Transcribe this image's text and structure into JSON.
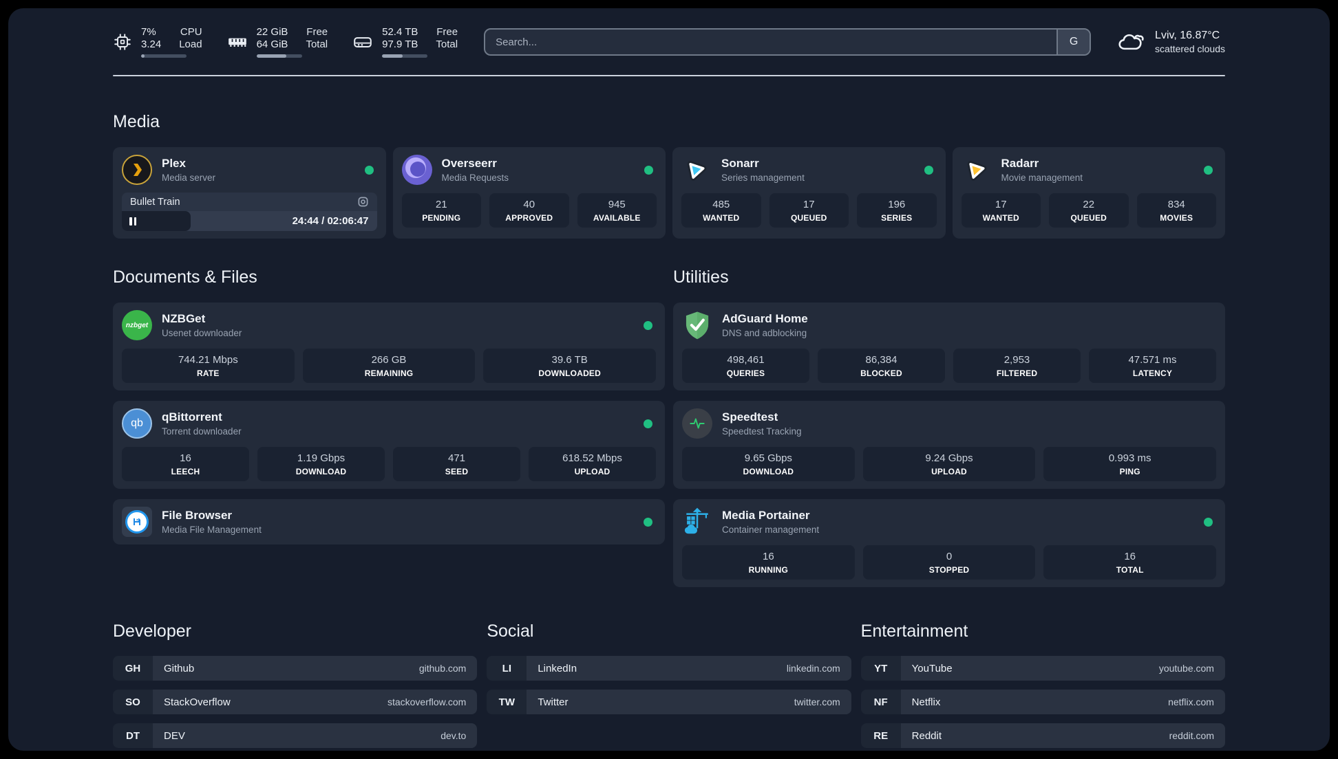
{
  "header": {
    "system_stats": [
      {
        "icon": "cpu-icon",
        "value1": "7%",
        "label1": "CPU",
        "value2": "3.24",
        "label2": "Load",
        "progress_pct": 8
      },
      {
        "icon": "ram-icon",
        "value1": "22 GiB",
        "label1": "Free",
        "value2": "64 GiB",
        "label2": "Total",
        "progress_pct": 66
      },
      {
        "icon": "disk-icon",
        "value1": "52.4 TB",
        "label1": "Free",
        "value2": "97.9 TB",
        "label2": "Total",
        "progress_pct": 46
      }
    ],
    "search": {
      "placeholder": "Search...",
      "button_label": "G"
    },
    "weather": {
      "location_temp": "Lviv, 16.87°C",
      "condition": "scattered clouds"
    }
  },
  "media": {
    "title": "Media",
    "plex": {
      "name": "Plex",
      "subtitle": "Media server",
      "stream": {
        "title": "Bullet Train",
        "time": "24:44 / 02:06:47",
        "progress_pct": 27
      }
    },
    "overseerr": {
      "name": "Overseerr",
      "subtitle": "Media Requests",
      "stats": [
        {
          "value": "21",
          "label": "PENDING"
        },
        {
          "value": "40",
          "label": "APPROVED"
        },
        {
          "value": "945",
          "label": "AVAILABLE"
        }
      ]
    },
    "sonarr": {
      "name": "Sonarr",
      "subtitle": "Series management",
      "stats": [
        {
          "value": "485",
          "label": "WANTED"
        },
        {
          "value": "17",
          "label": "QUEUED"
        },
        {
          "value": "196",
          "label": "SERIES"
        }
      ]
    },
    "radarr": {
      "name": "Radarr",
      "subtitle": "Movie management",
      "stats": [
        {
          "value": "17",
          "label": "WANTED"
        },
        {
          "value": "22",
          "label": "QUEUED"
        },
        {
          "value": "834",
          "label": "MOVIES"
        }
      ]
    }
  },
  "documents": {
    "title": "Documents & Files",
    "nzbget": {
      "name": "NZBGet",
      "subtitle": "Usenet downloader",
      "icon_text": "nzbget",
      "stats": [
        {
          "value": "744.21 Mbps",
          "label": "RATE"
        },
        {
          "value": "266 GB",
          "label": "REMAINING"
        },
        {
          "value": "39.6 TB",
          "label": "DOWNLOADED"
        }
      ]
    },
    "qbittorrent": {
      "name": "qBittorrent",
      "subtitle": "Torrent downloader",
      "icon_text": "qb",
      "stats": [
        {
          "value": "16",
          "label": "LEECH"
        },
        {
          "value": "1.19 Gbps",
          "label": "DOWNLOAD"
        },
        {
          "value": "471",
          "label": "SEED"
        },
        {
          "value": "618.52 Mbps",
          "label": "UPLOAD"
        }
      ]
    },
    "filebrowser": {
      "name": "File Browser",
      "subtitle": "Media File Management"
    }
  },
  "utilities": {
    "title": "Utilities",
    "adguard": {
      "name": "AdGuard Home",
      "subtitle": "DNS and adblocking",
      "stats": [
        {
          "value": "498,461",
          "label": "QUERIES"
        },
        {
          "value": "86,384",
          "label": "BLOCKED"
        },
        {
          "value": "2,953",
          "label": "FILTERED"
        },
        {
          "value": "47.571 ms",
          "label": "LATENCY"
        }
      ]
    },
    "speedtest": {
      "name": "Speedtest",
      "subtitle": "Speedtest Tracking",
      "stats": [
        {
          "value": "9.65 Gbps",
          "label": "DOWNLOAD"
        },
        {
          "value": "9.24 Gbps",
          "label": "UPLOAD"
        },
        {
          "value": "0.993 ms",
          "label": "PING"
        }
      ]
    },
    "portainer": {
      "name": "Media Portainer",
      "subtitle": "Container management",
      "stats": [
        {
          "value": "16",
          "label": "RUNNING"
        },
        {
          "value": "0",
          "label": "STOPPED"
        },
        {
          "value": "16",
          "label": "TOTAL"
        }
      ]
    }
  },
  "bookmarks": [
    {
      "title": "Developer",
      "links": [
        {
          "abbr": "GH",
          "name": "Github",
          "url": "github.com"
        },
        {
          "abbr": "SO",
          "name": "StackOverflow",
          "url": "stackoverflow.com"
        },
        {
          "abbr": "DT",
          "name": "DEV",
          "url": "dev.to"
        }
      ]
    },
    {
      "title": "Social",
      "links": [
        {
          "abbr": "LI",
          "name": "LinkedIn",
          "url": "linkedin.com"
        },
        {
          "abbr": "TW",
          "name": "Twitter",
          "url": "twitter.com"
        }
      ]
    },
    {
      "title": "Entertainment",
      "links": [
        {
          "abbr": "YT",
          "name": "YouTube",
          "url": "youtube.com"
        },
        {
          "abbr": "NF",
          "name": "Netflix",
          "url": "netflix.com"
        },
        {
          "abbr": "RE",
          "name": "Reddit",
          "url": "reddit.com"
        }
      ]
    }
  ],
  "colors": {
    "status_online": "#20bf82",
    "accent_plex": "#e5a00d"
  }
}
